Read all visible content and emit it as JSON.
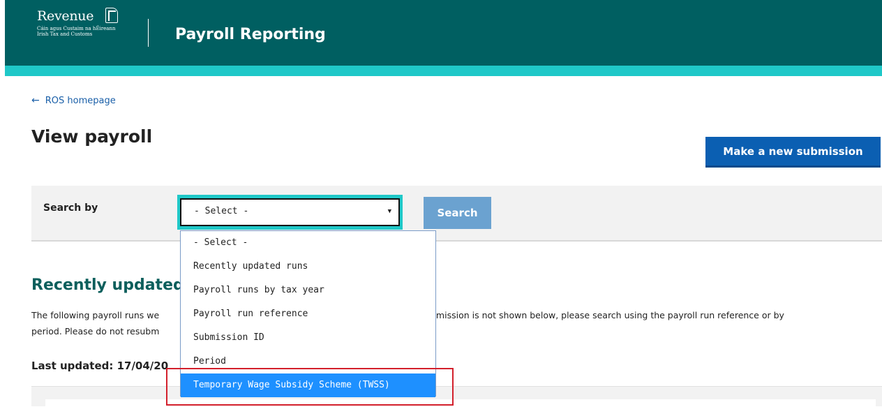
{
  "header": {
    "logo": {
      "word": "Revenue",
      "line1": "Cáin agus Custaim na hÉireann",
      "line2": "Irish Tax and Customs"
    },
    "title": "Payroll Reporting"
  },
  "nav": {
    "back_arrow": "←",
    "back_label": "ROS homepage"
  },
  "page": {
    "title": "View payroll",
    "new_submission_label": "Make a new submission"
  },
  "search": {
    "label": "Search by",
    "selected": "- Select -",
    "caret": "▼",
    "button_label": "Search",
    "options": [
      "- Select -",
      "Recently updated runs",
      "Payroll runs by tax year",
      "Payroll run reference",
      "Submission ID",
      "Period",
      "Temporary Wage Subsidy Scheme (TWSS)"
    ],
    "highlighted_index": 6
  },
  "recent": {
    "title": "Recently updated",
    "para_left_1": "The following payroll runs we",
    "para_left_2": "period. Please do not resubm",
    "para_right_1": "bmission is not shown below, please search using the payroll run reference or by",
    "last_updated": "Last updated: 17/04/20"
  },
  "colors": {
    "header_bg": "#005f61",
    "header_stripe": "#1fc8c8",
    "primary_button": "#0b5fb2",
    "search_button": "#6ba2d0",
    "selected_option": "#1e90ff",
    "annotation_box": "#d3202c",
    "section_title": "#0d5f5c"
  }
}
